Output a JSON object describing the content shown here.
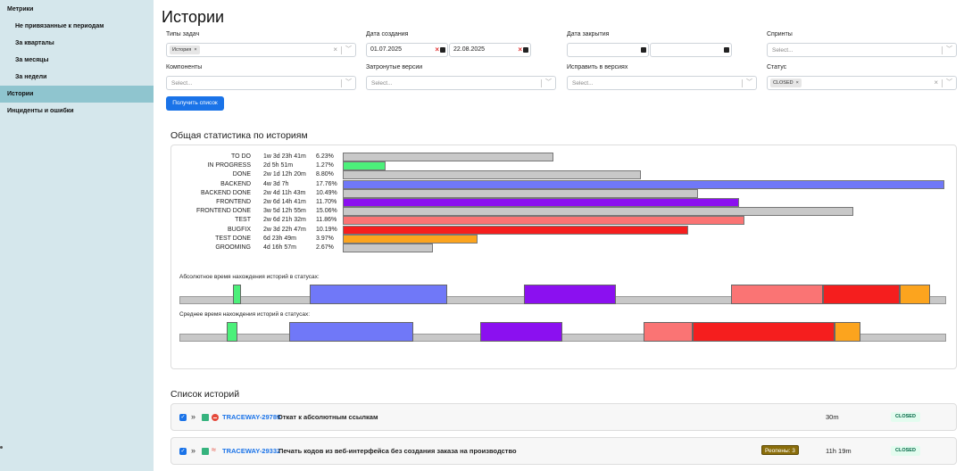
{
  "sidebar": {
    "items": [
      {
        "label": "Метрики",
        "level": 0,
        "active": false
      },
      {
        "label": "Не привязанные к периодам",
        "level": 1,
        "active": false
      },
      {
        "label": "За кварталы",
        "level": 1,
        "active": false
      },
      {
        "label": "За месяцы",
        "level": 1,
        "active": false
      },
      {
        "label": "За недели",
        "level": 1,
        "active": false
      },
      {
        "label": "Истории",
        "level": 0,
        "active": true
      },
      {
        "label": "Инциденты и ошибки",
        "level": 0,
        "active": false
      }
    ]
  },
  "page": {
    "title": "Истории"
  },
  "filters": {
    "issue_types": {
      "label": "Типы задач",
      "chip": "История"
    },
    "created": {
      "label": "Дата создания",
      "from": "01.07.2025",
      "to": "22.08.2025"
    },
    "closed": {
      "label": "Дата закрытия"
    },
    "sprints": {
      "label": "Спринты",
      "placeholder": "Select..."
    },
    "components": {
      "label": "Компоненты",
      "placeholder": "Select..."
    },
    "affected_versions": {
      "label": "Затронутые версии",
      "placeholder": "Select..."
    },
    "fix_versions": {
      "label": "Исправить в версиях",
      "placeholder": "Select..."
    },
    "status": {
      "label": "Статус",
      "chip": "CLOSED"
    },
    "submit_label": "Получить список"
  },
  "stats": {
    "title": "Общая статистика по историям",
    "rows": [
      {
        "name": "TO DO",
        "duration": "1w 3d 23h 41m",
        "percent": "6.23%",
        "color": "#c8c8c8"
      },
      {
        "name": "IN PROGRESS",
        "duration": "2d 5h 51m",
        "percent": "1.27%",
        "color": "#4cf07a"
      },
      {
        "name": "DONE",
        "duration": "2w 1d 12h 20m",
        "percent": "8.80%",
        "color": "#c8c8c8"
      },
      {
        "name": "BACKEND",
        "duration": "4w 3d 7h",
        "percent": "17.76%",
        "color": "#7078f8"
      },
      {
        "name": "BACKEND DONE",
        "duration": "2w 4d 11h 43m",
        "percent": "10.49%",
        "color": "#c8c8c8"
      },
      {
        "name": "FRONTEND",
        "duration": "2w 6d 14h 41m",
        "percent": "11.70%",
        "color": "#8b10f0"
      },
      {
        "name": "FRONTEND DONE",
        "duration": "3w 5d 12h 55m",
        "percent": "15.06%",
        "color": "#c8c8c8"
      },
      {
        "name": "TEST",
        "duration": "2w 6d 21h 32m",
        "percent": "11.86%",
        "color": "#fa7474"
      },
      {
        "name": "BUGFIX",
        "duration": "2w 3d 22h 47m",
        "percent": "10.19%",
        "color": "#f51e1e"
      },
      {
        "name": "TEST DONE",
        "duration": "6d 23h 49m",
        "percent": "3.97%",
        "color": "#fca41e"
      },
      {
        "name": "GROOMING",
        "duration": "4d 16h 57m",
        "percent": "2.67%",
        "color": "#c8c8c8"
      }
    ],
    "bar_scale_max_percent": 17.76,
    "absolute_label": "Абсолютное время нахождения историй в статусах:",
    "average_label": "Среднее время нахождения историй в статусах:",
    "absolute_segments": [
      {
        "color": "#4cf07a"
      },
      {
        "color": "#7078f8"
      },
      {
        "color": "#8b10f0"
      },
      {
        "color": "#fa7474"
      },
      {
        "color": "#f51e1e"
      },
      {
        "color": "#fca41e"
      }
    ],
    "average_segments": [
      {
        "color": "#4cf07a"
      },
      {
        "color": "#7078f8"
      },
      {
        "color": "#8b10f0"
      },
      {
        "color": "#fa7474"
      },
      {
        "color": "#f51e1e"
      },
      {
        "color": "#fca41e"
      }
    ]
  },
  "list": {
    "title": "Список историй",
    "items": [
      {
        "key": "TRACEWAY-29789",
        "summary": "Откат к абсолютным ссылкам",
        "time": "30m",
        "status": "CLOSED",
        "reopens": ""
      },
      {
        "key": "TRACEWAY-29332",
        "summary": "Печать кодов из веб-интерфейса без создания заказа на производство",
        "time": "11h 19m",
        "status": "CLOSED",
        "reopens": "Реопены: 3"
      }
    ]
  }
}
